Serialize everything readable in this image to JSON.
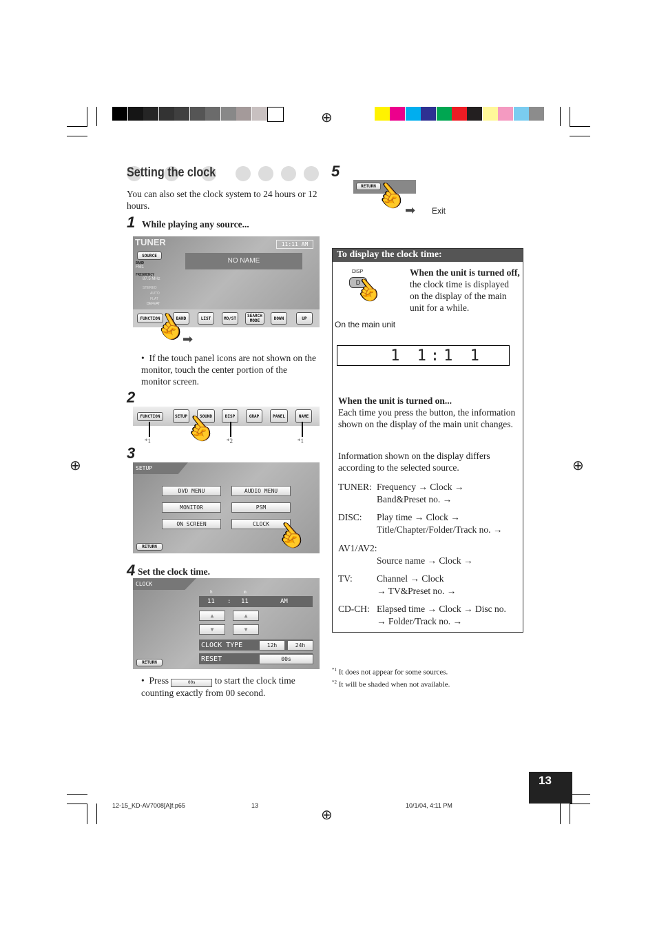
{
  "title": "Setting the clock",
  "intro": "You can also set the clock system to 24 hours or 12 hours.",
  "steps": {
    "s1": {
      "num": "1",
      "text": "While playing any source..."
    },
    "s2": {
      "num": "2"
    },
    "s3": {
      "num": "3"
    },
    "s4": {
      "num": "4",
      "text": "Set the clock time."
    },
    "s5": {
      "num": "5",
      "exit": "Exit"
    }
  },
  "tuner": {
    "title": "TUNER",
    "clock": "11:11 AM",
    "source": "SOURCE",
    "band_label": "BAND",
    "band": "FM1",
    "freq_label": "FREQUENCY",
    "freq": "87.5 MHz",
    "indicators": [
      "STEREO",
      "AUTO",
      "FLAT",
      "DEFEAT"
    ],
    "station": "NO NAME",
    "buttons": [
      "FUNCTION",
      "BAND",
      "LIST",
      "MO/ST",
      "SEARCH MODE",
      "DOWN",
      "UP"
    ]
  },
  "bullet1": "If the touch panel icons are not shown on the monitor, touch the center portion of the monitor screen.",
  "function_bar": {
    "buttons": [
      "FUNCTION",
      "SETUP",
      "SOUND",
      "DISP",
      "GRAP",
      "PANEL",
      "NAME"
    ],
    "notes": [
      "*1",
      "*2",
      "*1"
    ]
  },
  "setup": {
    "title": "SETUP",
    "buttons": [
      "DVD MENU",
      "AUDIO MENU",
      "MONITOR",
      "PSM",
      "ON SCREEN",
      "CLOCK"
    ],
    "return": "RETURN"
  },
  "clock_screen": {
    "title": "CLOCK",
    "h": "h",
    "m": "m",
    "hour": "11",
    "sep": ":",
    "minute": "11",
    "ampm": "AM",
    "clock_type": "CLOCK TYPE",
    "t12": "12h",
    "t24": "24h",
    "reset": "RESET",
    "reset_btn": "00s",
    "return": "RETURN"
  },
  "bullet2": {
    "pre": "Press",
    "btn": "00s",
    "post": "to start the clock time counting exactly from 00 second."
  },
  "return_btn": "RETURN",
  "box": {
    "title": "To display the clock time:",
    "disp_label": "DISP",
    "disp_key": "D",
    "main_unit": "On the main unit",
    "off_bold": "When the unit is turned off,",
    "off_text": " the clock time is displayed on the display of the main unit for a while.",
    "lcd": "1 1:1 1",
    "on_bold": "When the unit is turned on...",
    "on_text": "Each time you press the button, the information shown on the display of the main unit changes.",
    "info": "Information shown on the display differs according to the selected source.",
    "rows": [
      {
        "label": "TUNER:",
        "l1": "Frequency → Clock →",
        "l2": "Band&Preset no. →"
      },
      {
        "label": "DISC:",
        "l1": "Play time → Clock →",
        "l2": "Title/Chapter/Folder/Track no. →"
      },
      {
        "label": "AV1/AV2:",
        "l1": "Source name → Clock →",
        "l2": ""
      },
      {
        "label": "TV:",
        "l1": "Channel → Clock",
        "l2": "→ TV&Preset no. →"
      },
      {
        "label": "CD-CH:",
        "l1": "Elapsed time → Clock → Disc no.",
        "l2": "→ Folder/Track no. →"
      }
    ]
  },
  "footnotes": [
    {
      "mark": "*1",
      "text": "It does not appear for some sources."
    },
    {
      "mark": "*2",
      "text": "It will be shaded when not available."
    }
  ],
  "page_number": "13",
  "footer": {
    "file": "12-15_KD-AV7008[A]f.p65",
    "page": "13",
    "date": "10/1/04, 4:11 PM"
  },
  "colors": {
    "gray_bar": [
      "#000000",
      "#151515",
      "#252525",
      "#333333",
      "#3f3f3f",
      "#555555",
      "#6b6b6b",
      "#888888",
      "#a49a9a",
      "#c8c0c0",
      "#ffffff"
    ],
    "color_bar": [
      "#fff200",
      "#ec008c",
      "#00aeef",
      "#2e3192",
      "#00a651",
      "#ed1c24",
      "#231f20",
      "#fff799",
      "#f49ac1",
      "#7accf0",
      "#8c8c8c"
    ],
    "box_header": "#555555"
  }
}
